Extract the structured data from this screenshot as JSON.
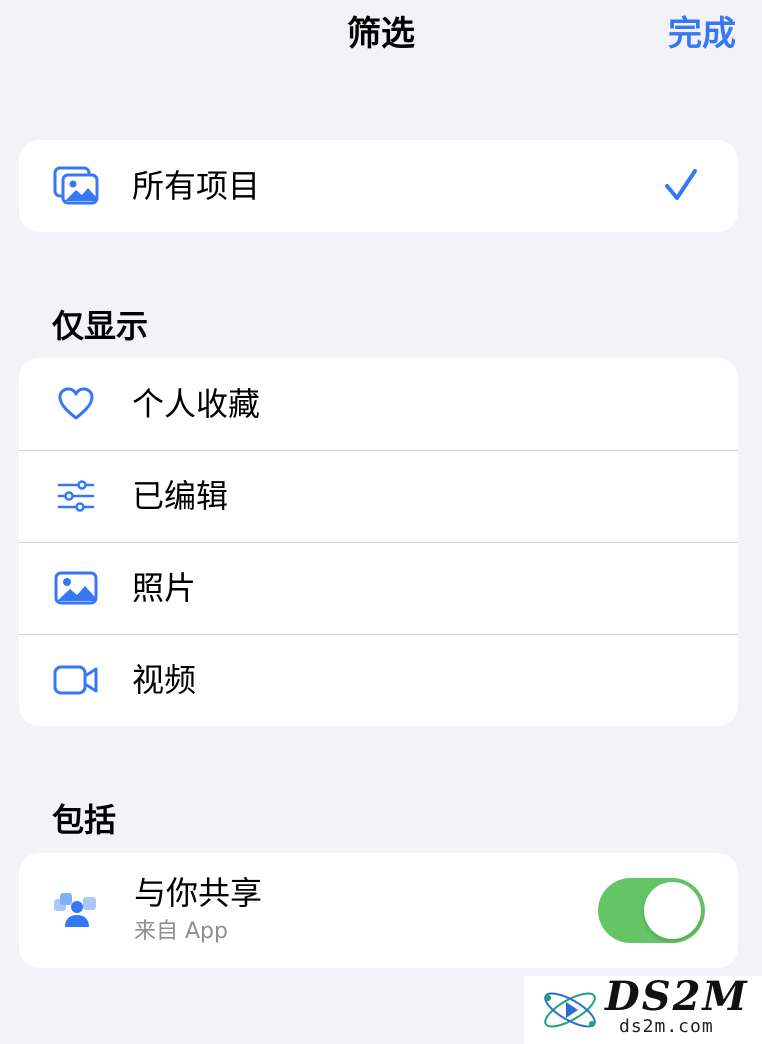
{
  "nav": {
    "title": "筛选",
    "done": "完成"
  },
  "all_items": {
    "label": "所有项目",
    "icon": "photo-stack-icon",
    "selected": true
  },
  "only_show": {
    "header": "仅显示",
    "items": [
      {
        "label": "个人收藏",
        "icon": "heart-icon"
      },
      {
        "label": "已编辑",
        "icon": "sliders-icon"
      },
      {
        "label": "照片",
        "icon": "photo-icon"
      },
      {
        "label": "视频",
        "icon": "video-camera-icon"
      }
    ]
  },
  "include": {
    "header": "包括",
    "shared": {
      "title": "与你共享",
      "subtitle": "来自 App",
      "icon": "shared-with-you-icon",
      "toggle_on": true
    }
  },
  "watermark": {
    "logo": "DS2M",
    "url": "ds2m.com"
  },
  "colors": {
    "accent": "#3478f6",
    "toggle_on": "#65c466",
    "background": "#f2f2f7"
  }
}
